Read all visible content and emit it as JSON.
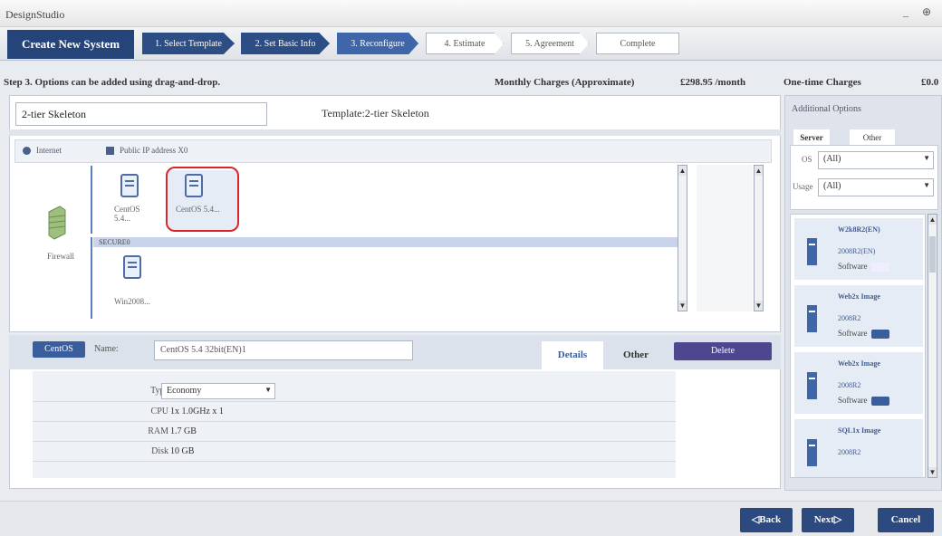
{
  "app_title": "DesignStudio",
  "window_buttons": "_ ⊕",
  "nav": {
    "brand": "Create New System",
    "steps": [
      {
        "label": "1. Select Template"
      },
      {
        "label": "2. Set Basic Info"
      },
      {
        "label": "3. Reconfigure"
      },
      {
        "label": "4. Estimate"
      },
      {
        "label": "5. Agreement"
      },
      {
        "label": "Complete"
      }
    ]
  },
  "subheader": {
    "instruction": "Step 3. Options can be added using drag-and-drop.",
    "monthly_label": "Monthly Charges (Approximate)",
    "monthly_value": "£298.95 /month",
    "onetime_label": "One-time Charges",
    "onetime_value": "£0.0"
  },
  "system": {
    "name_value": "2-tier Skeleton",
    "template_label": "Template:2-tier Skeleton",
    "internet_label": "Internet",
    "public_ip_label": "Public IP address X0",
    "firewall_label": "Firewall",
    "zone1_servers": [
      "CentOS 5.4...",
      "CentOS 5.4..."
    ],
    "zone2_header": "SECURE0",
    "zone2_servers": [
      "Win2008..."
    ]
  },
  "details": {
    "os_badge": "CentOS",
    "name_label": "Name:",
    "name_value": "CentOS 5.4 32bit(EN)1",
    "tab_details": "Details",
    "tab_other": "Other",
    "delete_label": "Delete",
    "type_label": "Type",
    "type_value": "Economy",
    "cpu_label": "CPU",
    "cpu_value": "1x 1.0GHz x 1",
    "ram_label": "RAM",
    "ram_value": "1.7 GB",
    "disk_label": "Disk",
    "disk_value": "10 GB"
  },
  "options": {
    "title": "Additional Options",
    "tab_server": "Server",
    "tab_other": "Other",
    "os_label": "OS",
    "os_value": "(All)",
    "usage_label": "Usage",
    "usage_value": "(All)",
    "items": [
      {
        "title": "W2k8R2(EN)",
        "sub": "2008R2(EN)",
        "software": "Software"
      },
      {
        "title": "Web2x Image",
        "sub": "2008R2",
        "software": "Software"
      },
      {
        "title": "Web2x Image",
        "sub": "2008R2",
        "software": "Software"
      },
      {
        "title": "SQL1x Image",
        "sub": "2008R2",
        "software": ""
      }
    ]
  },
  "footer": {
    "back": "◁Back",
    "next": "Next▷",
    "cancel": "Cancel"
  }
}
